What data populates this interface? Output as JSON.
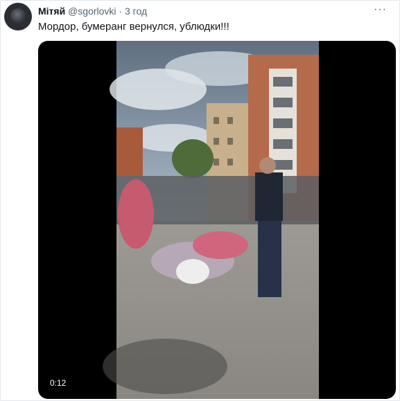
{
  "tweet": {
    "author_name": "Мітяй",
    "handle": "@sgorlovki",
    "separator": "·",
    "time": "3 год",
    "text": "Мордор, бумеранг вернулся, ублюдки!!!",
    "more_icon": "more-horizontal-icon"
  },
  "video": {
    "duration": "0:12"
  },
  "colors": {
    "text": "#0f1419",
    "muted": "#536471",
    "media_bg": "#000000"
  }
}
